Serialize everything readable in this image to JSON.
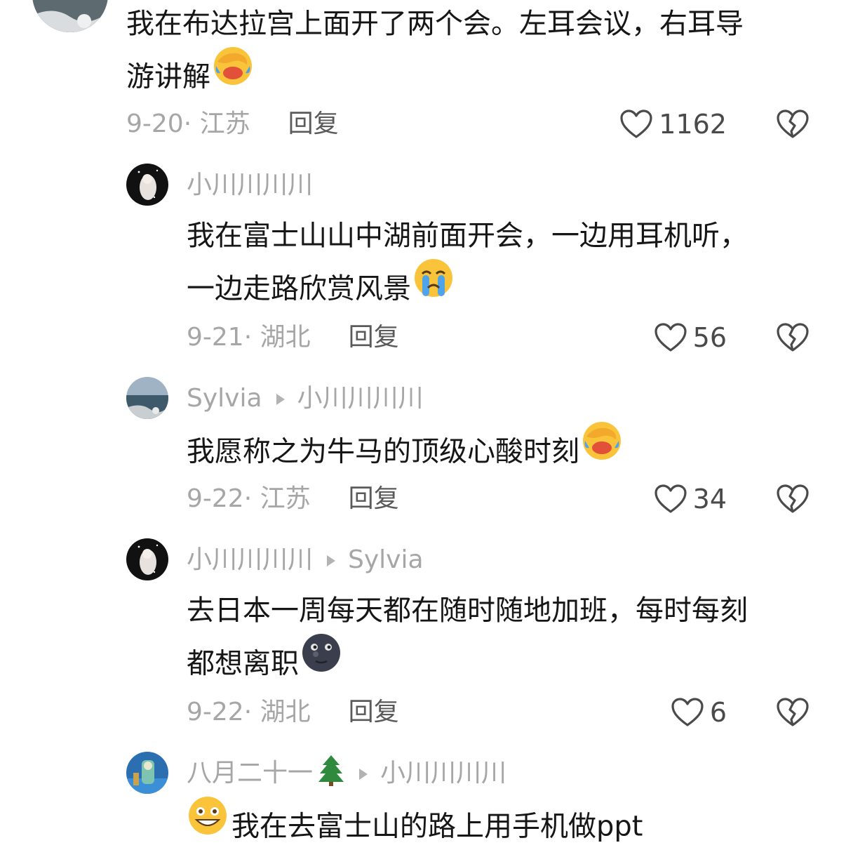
{
  "comments": [
    {
      "id": "c1",
      "text_lines": [
        "我在布达拉宫上面开了两个会。左耳会议，右耳导",
        "游讲解"
      ],
      "emoji": "facepalm-laugh-emoji",
      "date": "9-20· 江苏",
      "reply": "回复",
      "likes": "1162"
    },
    {
      "id": "c2",
      "username": "小川川川川",
      "text_lines": [
        "我在富士山山中湖前面开会，一边用耳机听，",
        "一边走路欣赏风景"
      ],
      "emoji": "crying-emoji",
      "date": "9-21· 湖北",
      "reply": "回复",
      "likes": "56"
    },
    {
      "id": "c3",
      "username": "Sylvia",
      "reply_to": "小川川川川",
      "text_lines": [
        "我愿称之为牛马的顶级心酸时刻"
      ],
      "emoji": "facepalm-laugh-emoji",
      "date": "9-22· 江苏",
      "reply": "回复",
      "likes": "34"
    },
    {
      "id": "c4",
      "username": "小川川川川",
      "reply_to": "Sylvia",
      "text_lines": [
        "去日本一周每天都在随时随地加班，每时每刻",
        "都想离职"
      ],
      "emoji": "new-moon-face-emoji",
      "date": "9-22· 湖北",
      "reply": "回复",
      "likes": "6"
    },
    {
      "id": "c5",
      "username": "八月二十一",
      "username_emoji": "evergreen-tree-emoji",
      "reply_to": "小川川川川",
      "text_lines": [
        "我在去富士山的路上用手机做ppt"
      ],
      "leading_emoji": "grinning-face-emoji"
    }
  ],
  "colors": {
    "meta_gray": "#a6a6a6",
    "reply_gray": "#5a5a5a",
    "text": "#161616",
    "emoji_yellow": "#f9c43a"
  }
}
